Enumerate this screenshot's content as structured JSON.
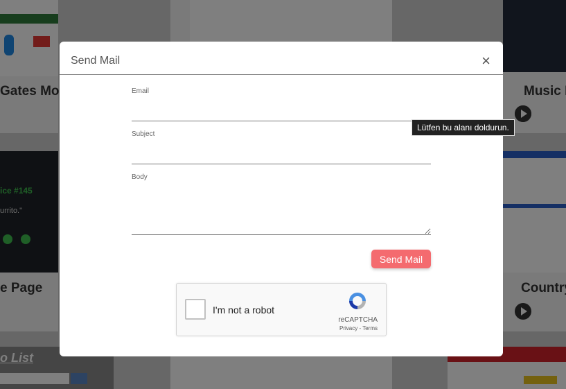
{
  "background": {
    "cards": [
      {
        "title": "Gates Monc"
      },
      {
        "title": "Music P"
      },
      {
        "title": "e Page"
      },
      {
        "title": "Country"
      },
      {
        "title": "o List"
      }
    ],
    "snippet_a": "ice #145",
    "snippet_b": "urrito.\""
  },
  "modal": {
    "title": "Send Mail",
    "close_label": "×",
    "email_label": "Email",
    "email_value": "",
    "subject_label": "Subject",
    "subject_value": "",
    "body_label": "Body",
    "body_value": "",
    "send_label": "Send Mail"
  },
  "recaptcha": {
    "label": "I'm not a robot",
    "brand": "reCAPTCHA",
    "terms": "Privacy - Terms"
  },
  "tooltip": {
    "text": "Lütfen bu alanı doldurun."
  },
  "colors": {
    "accent": "#f46b6f",
    "recaptcha_blue": "#4a90e2",
    "recaptcha_gray": "#b3b3b3"
  }
}
